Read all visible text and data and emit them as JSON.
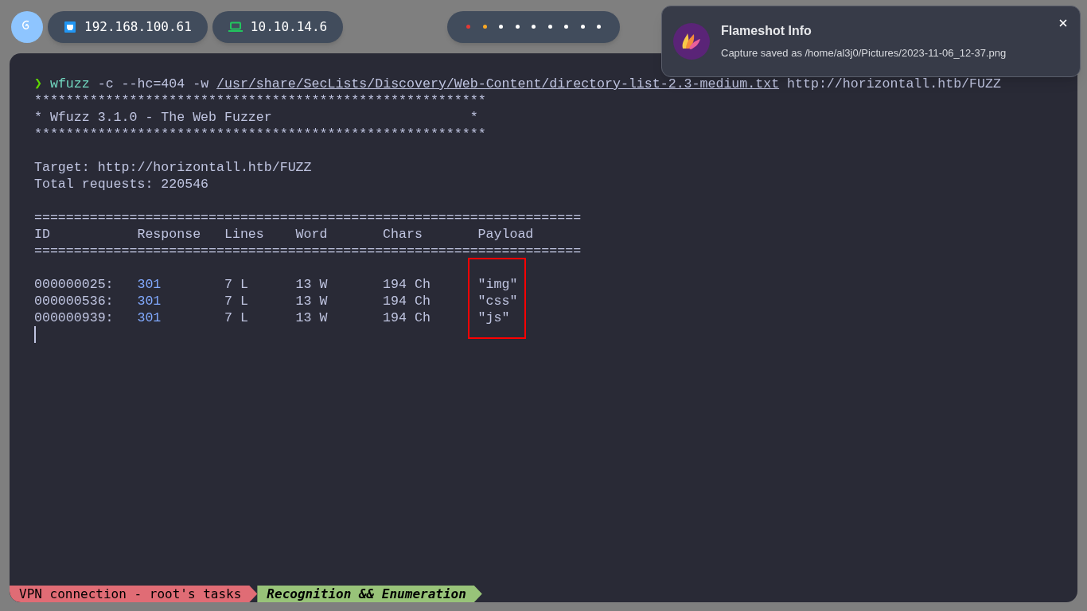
{
  "top_bar": {
    "addresses": [
      {
        "kind": "ethernet",
        "label": "192.168.100.61"
      },
      {
        "kind": "laptop",
        "label": "10.10.14.6"
      }
    ],
    "workspaces": [
      {
        "color": "#e53935"
      },
      {
        "color": "#f9a825"
      },
      {
        "color": "#ffffff"
      },
      {
        "color": "#ffffff"
      },
      {
        "color": "#ffffff"
      },
      {
        "color": "#ffffff"
      },
      {
        "color": "#ffffff"
      },
      {
        "color": "#ffffff"
      },
      {
        "color": "#ffffff"
      }
    ]
  },
  "terminal": {
    "prompt": {
      "symbol": "❯",
      "program": "wfuzz",
      "options": "-c --hc=404 -w",
      "wordlist": "/usr/share/SecLists/Discovery/Web-Content/directory-list-2.3-medium.txt",
      "url": "http://horizontall.htb/FUZZ"
    },
    "banner": [
      "*********************************************************",
      "* Wfuzz 3.1.0 - The Web Fuzzer                         *",
      "*********************************************************"
    ],
    "target": "Target: http://horizontall.htb/FUZZ",
    "total": "Total requests: 220546",
    "separator": "=====================================================================",
    "columns": [
      "ID",
      "Response",
      "Lines",
      "Word",
      "Chars",
      "Payload"
    ],
    "rows": [
      {
        "id": "000000025:",
        "response": "301",
        "lines": "7 L",
        "word": "13 W",
        "chars": "194 Ch",
        "payload": "\"img\""
      },
      {
        "id": "000000536:",
        "response": "301",
        "lines": "7 L",
        "word": "13 W",
        "chars": "194 Ch",
        "payload": "\"css\""
      },
      {
        "id": "000000939:",
        "response": "301",
        "lines": "7 L",
        "word": "13 W",
        "chars": "194 Ch",
        "payload": "\"js\""
      }
    ],
    "status_segments": [
      {
        "label": "VPN connection - root's tasks",
        "color": "#e06c75",
        "bold": false
      },
      {
        "label": "Recognition && Enumeration",
        "color": "#98c379",
        "bold": true
      }
    ]
  },
  "notification": {
    "title": "Flameshot Info",
    "body": "Capture saved as /home/al3j0/Pictures/2023-11-06_12-37.png"
  }
}
